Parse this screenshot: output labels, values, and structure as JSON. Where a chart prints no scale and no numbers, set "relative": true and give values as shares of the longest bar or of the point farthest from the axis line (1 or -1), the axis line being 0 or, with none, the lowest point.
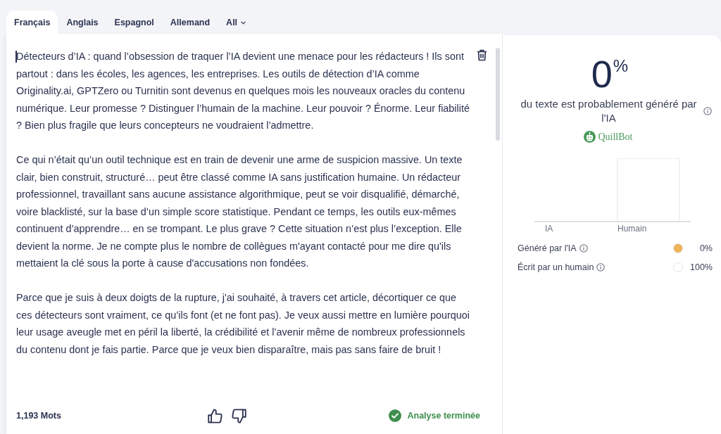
{
  "tabs": [
    {
      "label": "Français",
      "selected": true,
      "kind": "tab"
    },
    {
      "label": "Anglais",
      "selected": false,
      "kind": "tab"
    },
    {
      "label": "Espagnol",
      "selected": false,
      "kind": "tab"
    },
    {
      "label": "Allemand",
      "selected": false,
      "kind": "tab"
    },
    {
      "label": "All",
      "selected": false,
      "kind": "dropdown"
    }
  ],
  "editor": {
    "paragraphs": [
      "Détecteurs d’IA : quand l’obsession de traquer l’IA devient une menace pour les rédacteurs ! Ils sont partout : dans les écoles, les agences, les entreprises. Les outils de détection d’IA comme Originality.ai, GPTZero ou Turnitin sont devenus en quelques mois les nouveaux oracles du contenu numérique. Leur promesse ? Distinguer l’humain de la machine. Leur pouvoir ? Énorme. Leur fiabilité ? Bien plus fragile que leurs concepteurs ne voudraient l’admettre.",
      "Ce qui n’était qu’un outil technique est en train de devenir une arme de suspicion massive. Un texte clair, bien construit, structuré… peut être classé comme IA sans justification humaine. Un rédacteur professionnel, travaillant sans aucune assistance algorithmique, peut se voir disqualifié, démarché, voire blacklisté, sur la base d’un simple score statistique. Pendant ce temps, les outils eux-mêmes continuent d’apprendre… en se trompant. Le plus grave ? Cette situation n’est plus l’exception. Elle devient la norme. Je ne compte plus le nombre de collègues m'ayant contacté pour me dire qu'ils mettaient la clé sous la porte à cause d'accusations non fondées.",
      "Parce que je suis à deux doigts de la rupture, j'ai souhaité, à travers cet article, décortiquer ce que ces détecteurs sont vraiment, ce qu’ils font (et ne font pas). Je veux aussi mettre en lumière pourquoi leur usage aveugle met en péril la liberté, la crédibilité et l’avenir même de nombreux professionnels du contenu dont je fais partie. Parce que je veux bien disparaître, mais pas sans faire de bruit !"
    ]
  },
  "footer": {
    "word_count": "1,193 Mots",
    "status": "Analyse terminée"
  },
  "result": {
    "score": "0$^{%}$",
    "description": "du texte est probablement généré par l'IA",
    "brand": "QuillBot",
    "chart_data": {
      "type": "bar",
      "categories": [
        "IA",
        "Humain"
      ],
      "values": [
        0,
        1
      ],
      "relative": true
    },
    "legend": [
      {
        "label": "Généré par l'IA",
        "color": "#f0b35a",
        "value": "0%"
      },
      {
        "label": "Écrit par un humain",
        "color": "#ffffff",
        "value": "100%"
      }
    ]
  }
}
